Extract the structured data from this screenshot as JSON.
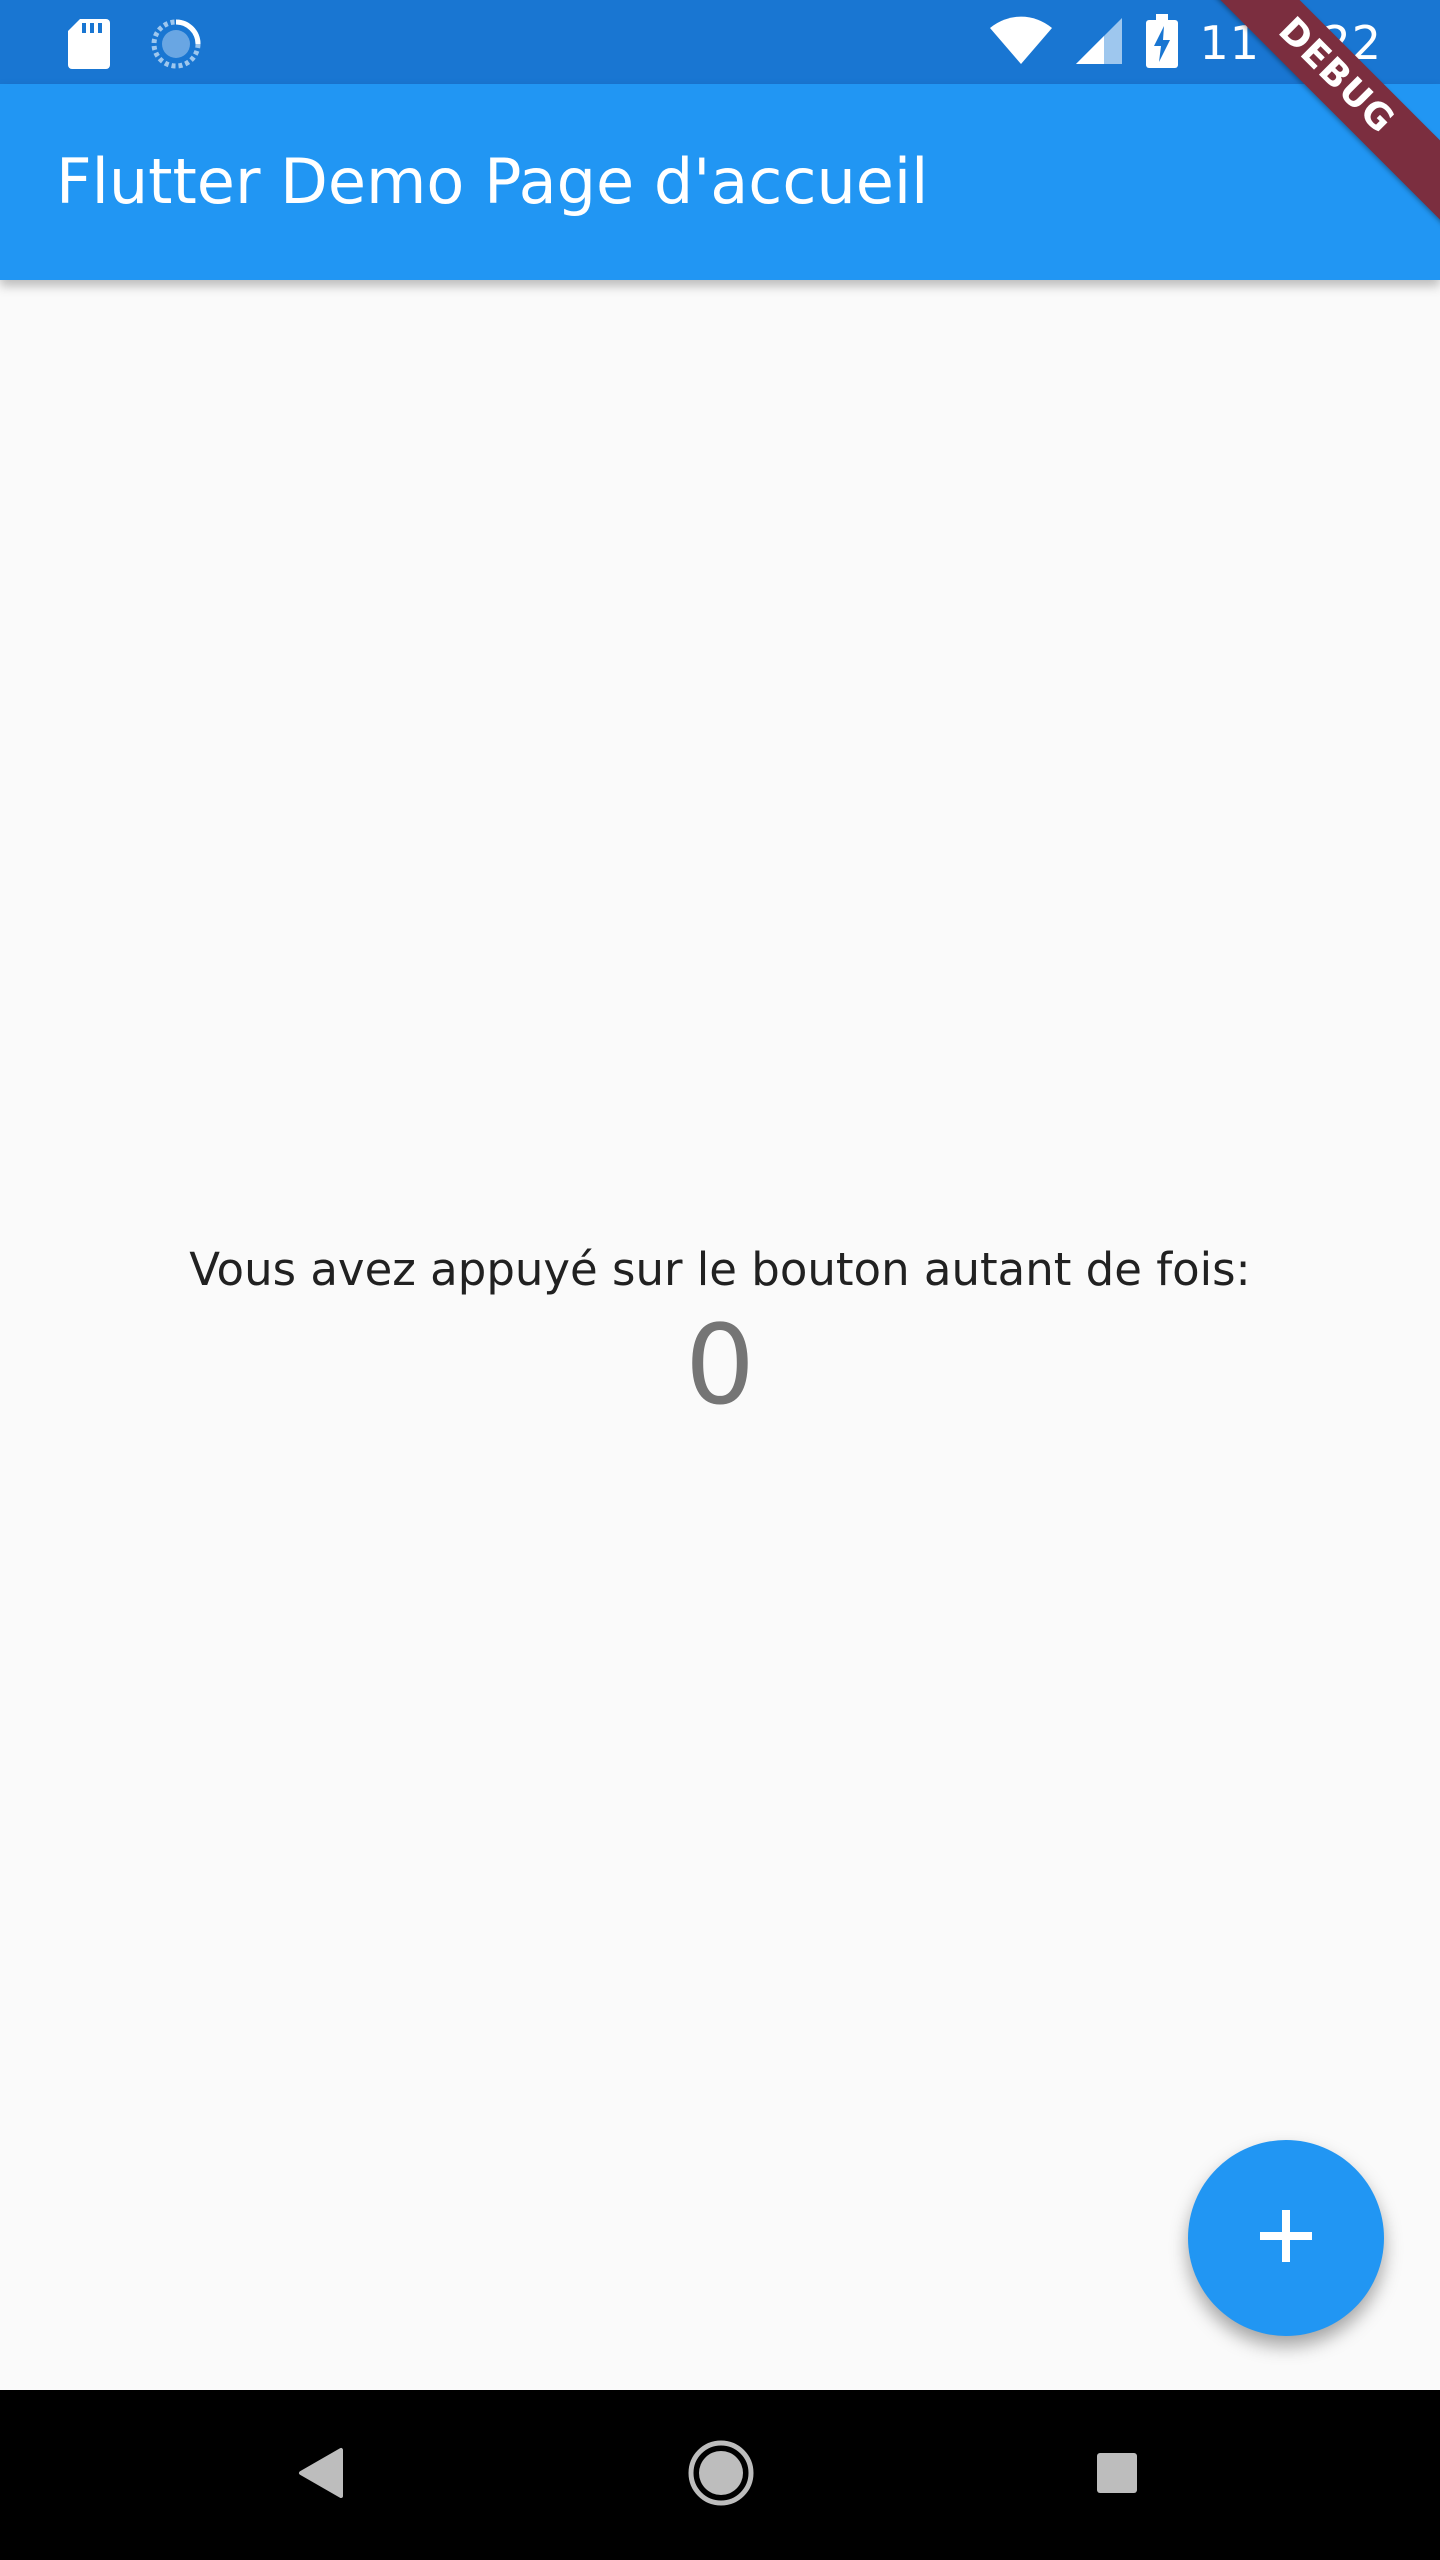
{
  "status_bar": {
    "time": "11 h 22",
    "icons": [
      "sd-card-icon",
      "sync-icon",
      "wifi-icon",
      "cellular-signal-icon",
      "battery-charging-icon"
    ],
    "background": "#1976d2"
  },
  "app_bar": {
    "title": "Flutter Demo Page d'accueil",
    "background": "#2196f3"
  },
  "debug_banner": {
    "label": "DEBUG",
    "color": "#7b2e3f"
  },
  "body": {
    "counter_label": "Vous avez appuyé sur le bouton autant de fois:",
    "counter_value": "0"
  },
  "fab": {
    "icon": "add-icon",
    "color": "#2196f3"
  },
  "nav_bar": {
    "icons": [
      "back-icon",
      "home-icon",
      "recents-icon"
    ]
  }
}
